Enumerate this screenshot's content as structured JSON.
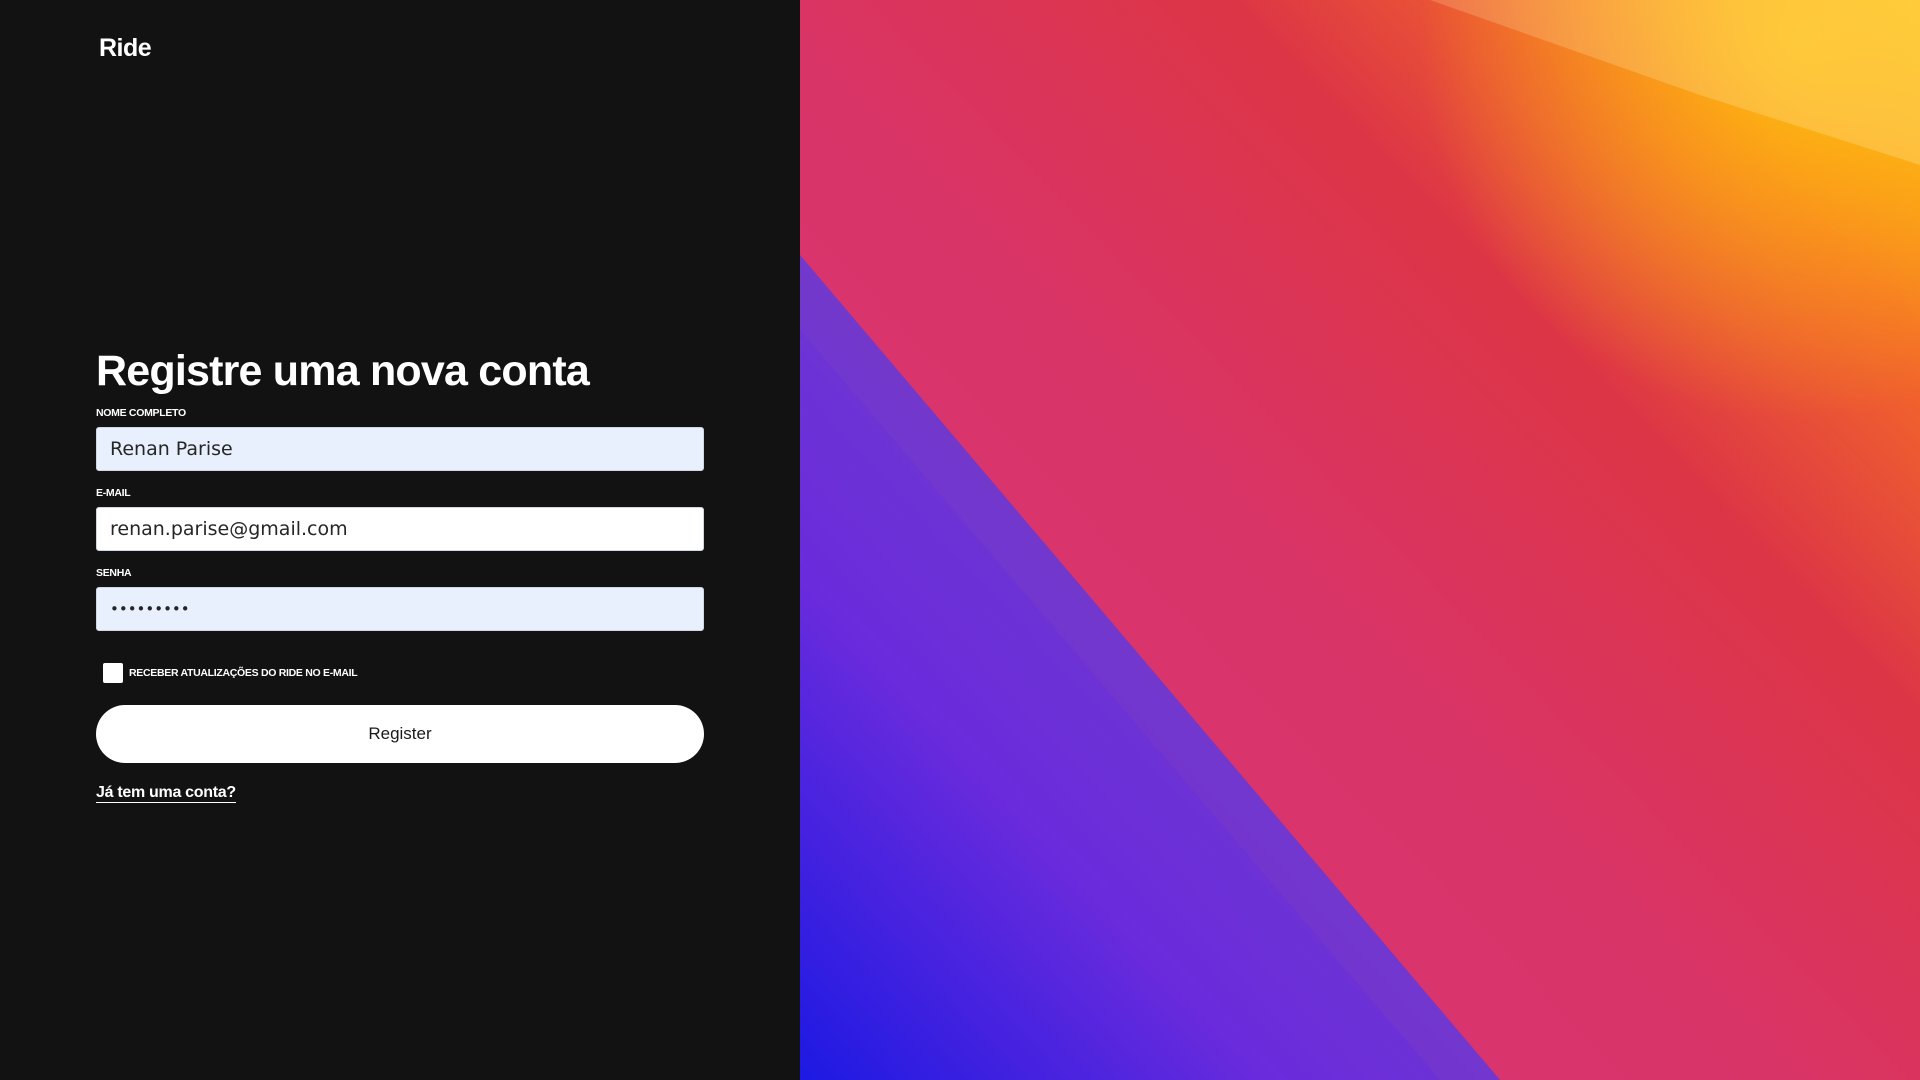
{
  "brand": {
    "logo_text": "Ride"
  },
  "form": {
    "title": "Registre uma nova conta",
    "full_name": {
      "label": "NOME COMPLETO",
      "value": "Renan Parise"
    },
    "email": {
      "label": "E-MAIL",
      "value": "renan.parise@gmail.com"
    },
    "password": {
      "label": "SENHA",
      "value": "•••••••••"
    },
    "newsletter_checkbox": {
      "label": "RECEBER ATUALIZAÇÕES DO RIDE NO E-MAIL",
      "checked": false
    },
    "register_button": "Register",
    "login_link": "Já tem uma conta?"
  },
  "colors": {
    "panel_background": "#121212",
    "autofill_background": "#e8f0fe",
    "gradient": [
      "#1d19e3",
      "#7a2fd9",
      "#d8367a",
      "#dc3546",
      "#f46a28",
      "#ffc20e"
    ]
  }
}
